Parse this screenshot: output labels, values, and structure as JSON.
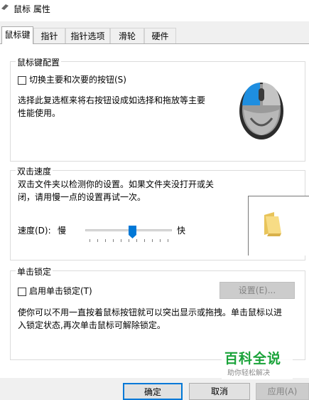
{
  "window": {
    "title": "鼠标 属性"
  },
  "tabs": [
    {
      "label": "鼠标键"
    },
    {
      "label": "指针"
    },
    {
      "label": "指针选项"
    },
    {
      "label": "滑轮"
    },
    {
      "label": "硬件"
    }
  ],
  "buttons_group": {
    "title": "鼠标键配置",
    "switch_label": "切换主要和次要的按钮(S)",
    "switch_checked": false,
    "description_line1": "选择此复选框来将右按钮设成如选择和拖放等主要",
    "description_line2": "性能使用。"
  },
  "double_click_group": {
    "title": "双击速度",
    "description_line1": "双击文件夹以检测你的设置。如果文件夹没打开或关",
    "description_line2": "闭，请用慢一点的设置再试一次。",
    "speed_label": "速度(D):",
    "slow_label": "慢",
    "fast_label": "快",
    "speed_value": 0.55
  },
  "click_lock_group": {
    "title": "单击锁定",
    "enable_label": "启用单击锁定(T)",
    "enable_checked": false,
    "settings_button": "设置(E)...",
    "description_line1": "使你可以不用一直按着鼠标按钮就可以突出显示或拖拽。单击鼠标以进",
    "description_line2": "入锁定状态,再次单击鼠标可解除锁定。"
  },
  "footer": {
    "ok": "确定",
    "cancel": "取消",
    "apply": "应用(A)"
  },
  "watermark": {
    "title": "百科全说",
    "subtitle": "助你轻松解决"
  },
  "colors": {
    "accent": "#0078d7",
    "mouse_highlight": "#1e8ee0",
    "watermark_green": "#1aa33a"
  }
}
